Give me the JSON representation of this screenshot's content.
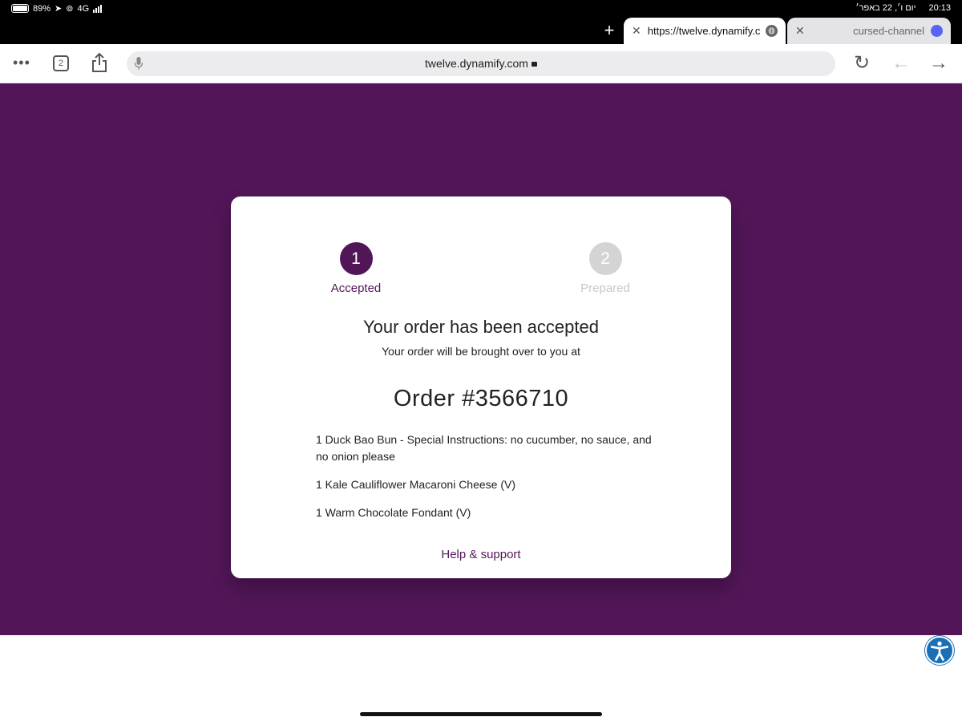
{
  "status_bar": {
    "battery": "89%",
    "network": "4G",
    "date": "יום ו׳, 22 באפר׳",
    "time": "20:13",
    "battery_level": 0.89
  },
  "tabs": [
    {
      "title": "https://twelve.dynamify.c",
      "active": true,
      "icon": "globe-icon"
    },
    {
      "title": "cursed-channel",
      "active": false,
      "icon": "discord-icon"
    }
  ],
  "toolbar": {
    "tab_count": "2",
    "url": "twelve.dynamify.com"
  },
  "progress": {
    "steps": [
      {
        "number": "1",
        "label": "Accepted",
        "state": "active"
      },
      {
        "number": "2",
        "label": "Prepared",
        "state": "inactive"
      }
    ]
  },
  "order": {
    "heading": "Your order has been accepted",
    "subheading": "Your order will be brought over to you at",
    "number": "Order #3566710",
    "items": [
      "1 Duck Bao Bun - Special Instructions: no cucumber, no sauce, and no onion please",
      "1 Kale Cauliflower Macaroni Cheese (V)",
      "1 Warm Chocolate Fondant (V)"
    ],
    "help_link": "Help & support"
  },
  "colors": {
    "brand": "#521658",
    "inactive_step": "#d4d4d4"
  }
}
